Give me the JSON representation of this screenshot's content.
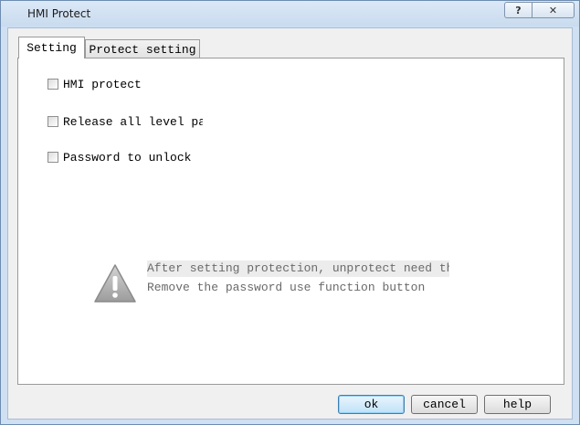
{
  "window": {
    "title": "HMI Protect",
    "help_glyph": "?",
    "close_glyph": "✕"
  },
  "tabs": [
    {
      "label": "Setting",
      "active": true
    },
    {
      "label": "Protect setting",
      "active": false
    }
  ],
  "options": [
    {
      "label": "HMI protect",
      "checked": false
    },
    {
      "label": "Release all level pass",
      "checked": false
    },
    {
      "label": "Password to unlock",
      "checked": false
    }
  ],
  "message": {
    "line1": "After setting protection, unprotect need this pa",
    "line2": "Remove the password use function button",
    "icon": "warning-icon"
  },
  "buttons": {
    "ok": "ok",
    "cancel": "cancel",
    "help": "help"
  }
}
